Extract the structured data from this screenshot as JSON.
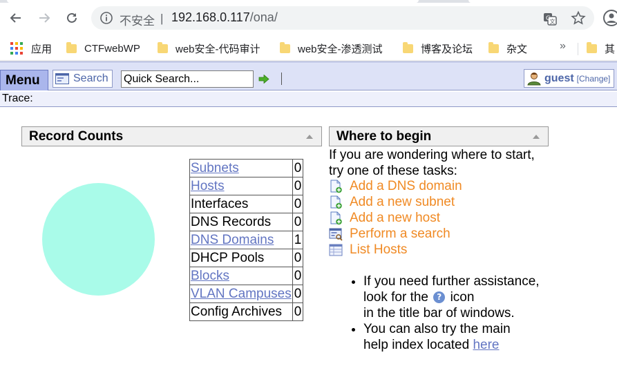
{
  "browser": {
    "security_label": "不安全",
    "separator": "|",
    "url_host": "192.168.0.117",
    "url_path": "/ona/",
    "bookmarks": [
      {
        "label": "应用"
      },
      {
        "label": "CTFwebWP"
      },
      {
        "label": "web安全-代码审计"
      },
      {
        "label": "web安全-渗透测试"
      },
      {
        "label": "博客及论坛"
      },
      {
        "label": "杂文"
      },
      {
        "label": "其"
      }
    ],
    "bookmarks_more": "»",
    "app_grid_colors": [
      "#ea4335",
      "#fbbc05",
      "#34a853",
      "#4285f4",
      "#ea4335",
      "#fbbc05",
      "#34a853",
      "#4285f4",
      "#ea4335"
    ]
  },
  "ona": {
    "menu_label": "Menu",
    "search_label": "Search",
    "quick_search_value": "Quick Search...",
    "user_name": "guest",
    "user_change": "[Change]",
    "trace_label": "Trace:"
  },
  "record_counts": {
    "title": "Record Counts",
    "pie_color": "#a9fbe9",
    "rows": [
      {
        "label": "Subnets",
        "count": "0",
        "link": true
      },
      {
        "label": "Hosts",
        "count": "0",
        "link": true
      },
      {
        "label": "Interfaces",
        "count": "0",
        "link": false
      },
      {
        "label": "DNS Records",
        "count": "0",
        "link": false
      },
      {
        "label": "DNS Domains",
        "count": "1",
        "link": true
      },
      {
        "label": "DHCP Pools",
        "count": "0",
        "link": false
      },
      {
        "label": "Blocks",
        "count": "0",
        "link": true
      },
      {
        "label": "VLAN Campuses",
        "count": "0",
        "link": true
      },
      {
        "label": "Config Archives",
        "count": "0",
        "link": false
      }
    ]
  },
  "where_to_begin": {
    "title": "Where to begin",
    "intro_1": "If you are wondering where to start,",
    "intro_2": "try one of these tasks:",
    "tasks": [
      {
        "label": "Add a DNS domain",
        "icon": "add-page-icon"
      },
      {
        "label": "Add a new subnet",
        "icon": "add-page-icon"
      },
      {
        "label": "Add a new host",
        "icon": "add-page-icon"
      },
      {
        "label": "Perform a search",
        "icon": "search-form-icon"
      },
      {
        "label": "List Hosts",
        "icon": "list-table-icon"
      }
    ],
    "help_1a": "If you need further assistance,",
    "help_1b": "look for the",
    "help_1c": "icon",
    "help_1d": "in the title bar of windows.",
    "help_2a": "You can also try the main",
    "help_2b": "help index located",
    "help_2_link": "here"
  }
}
